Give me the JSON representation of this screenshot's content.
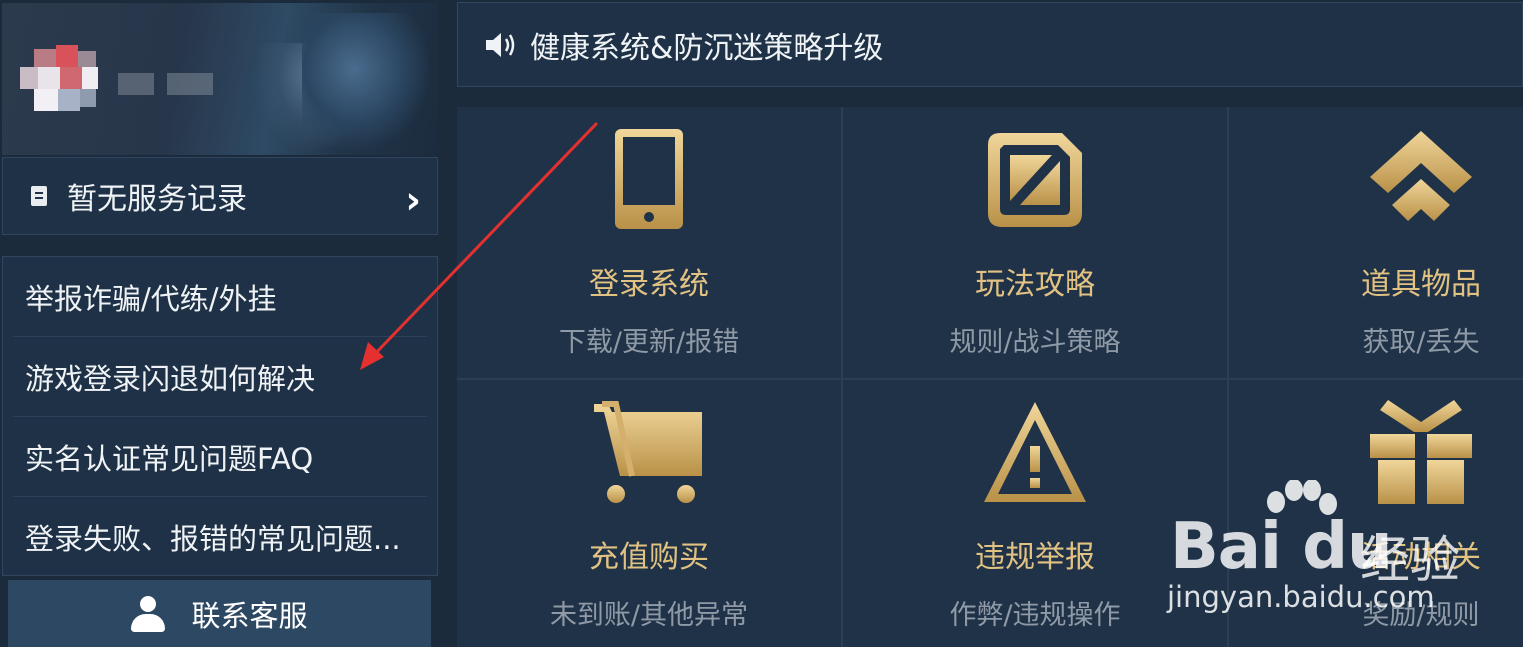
{
  "notice": {
    "text": "健康系统&防沉迷策略升级",
    "icon": "speaker-icon"
  },
  "service": {
    "label": "暂无服务记录",
    "icon": "document-icon",
    "chevron": "›"
  },
  "faq_items": [
    {
      "label": "举报诈骗/代练/外挂"
    },
    {
      "label": "游戏登录闪退如何解决"
    },
    {
      "label": "实名认证常见问题FAQ"
    },
    {
      "label": "登录失败、报错的常见问题..."
    }
  ],
  "contact": {
    "label": "联系客服",
    "icon": "person-icon"
  },
  "tiles": [
    {
      "title": "登录系统",
      "sub": "下载/更新/报错",
      "icon": "tablet-icon"
    },
    {
      "title": "玩法攻略",
      "sub": "规则/战斗策略",
      "icon": "strategy-icon"
    },
    {
      "title": "道具物品",
      "sub": "获取/丢失",
      "icon": "chevron-up-icon"
    },
    {
      "title": "充值购买",
      "sub": "未到账/其他异常",
      "icon": "cart-icon"
    },
    {
      "title": "违规举报",
      "sub": "作弊/违规操作",
      "icon": "warning-icon"
    },
    {
      "title": "活动相关",
      "sub": "奖励/规则",
      "icon": "gift-icon"
    }
  ],
  "watermark": {
    "logo": "Bai du",
    "brand": "经验",
    "url": "jingyan.baidu.com"
  },
  "colors": {
    "background": "#1b2b3c",
    "panel": "#1e3146",
    "gold": "#e2c283",
    "muted": "#8f9aa6",
    "annotation": "#e53030"
  }
}
